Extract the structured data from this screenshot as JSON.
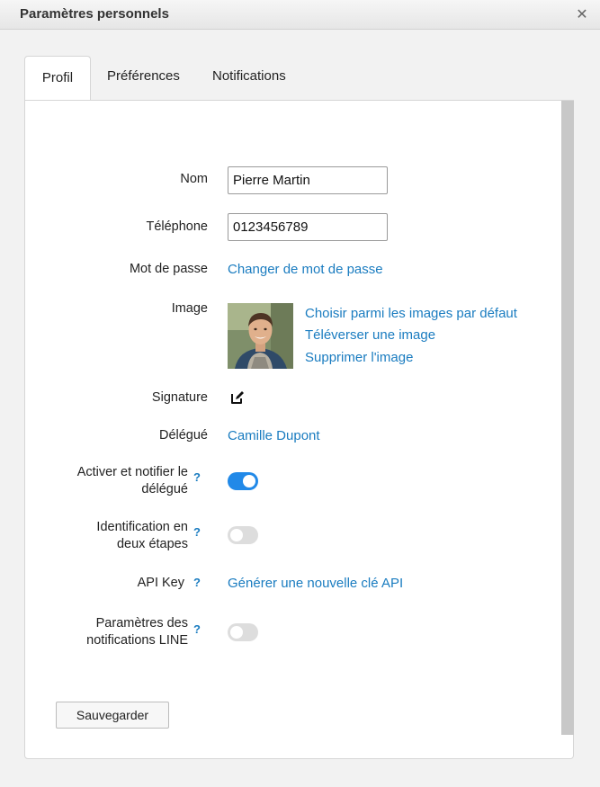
{
  "window": {
    "title": "Paramètres personnels",
    "close_icon": "close-icon"
  },
  "tabs": [
    {
      "label": "Profil",
      "active": true
    },
    {
      "label": "Préférences",
      "active": false
    },
    {
      "label": "Notifications",
      "active": false
    }
  ],
  "form": {
    "name_label": "Nom",
    "name_value": "Pierre Martin",
    "phone_label": "Téléphone",
    "phone_value": "0123456789",
    "password_label": "Mot de passe",
    "password_link": "Changer de mot de passe",
    "image_label": "Image",
    "image_links": [
      "Choisir parmi les images par défaut",
      "Téléverser une image",
      "Supprimer l'image"
    ],
    "signature_label": "Signature",
    "signature_icon": "edit-icon",
    "delegate_label": "Délégué",
    "delegate_value": "Camille Dupont",
    "notify_delegate_label_1": "Activer et notifier le",
    "notify_delegate_label_2": "délégué",
    "notify_delegate_on": true,
    "two_step_label_1": "Identification en",
    "two_step_label_2": "deux étapes",
    "two_step_on": false,
    "api_key_label": "API Key",
    "api_key_link": "Générer une nouvelle clé API",
    "line_label_1": "Paramètres des",
    "line_label_2": "notifications LINE",
    "line_on": false,
    "help_mark": "?"
  },
  "actions": {
    "save_label": "Sauvegarder"
  },
  "colors": {
    "accent": "#1a7cc0",
    "toggle_on": "#2189e8",
    "toggle_off": "#dddddd"
  }
}
